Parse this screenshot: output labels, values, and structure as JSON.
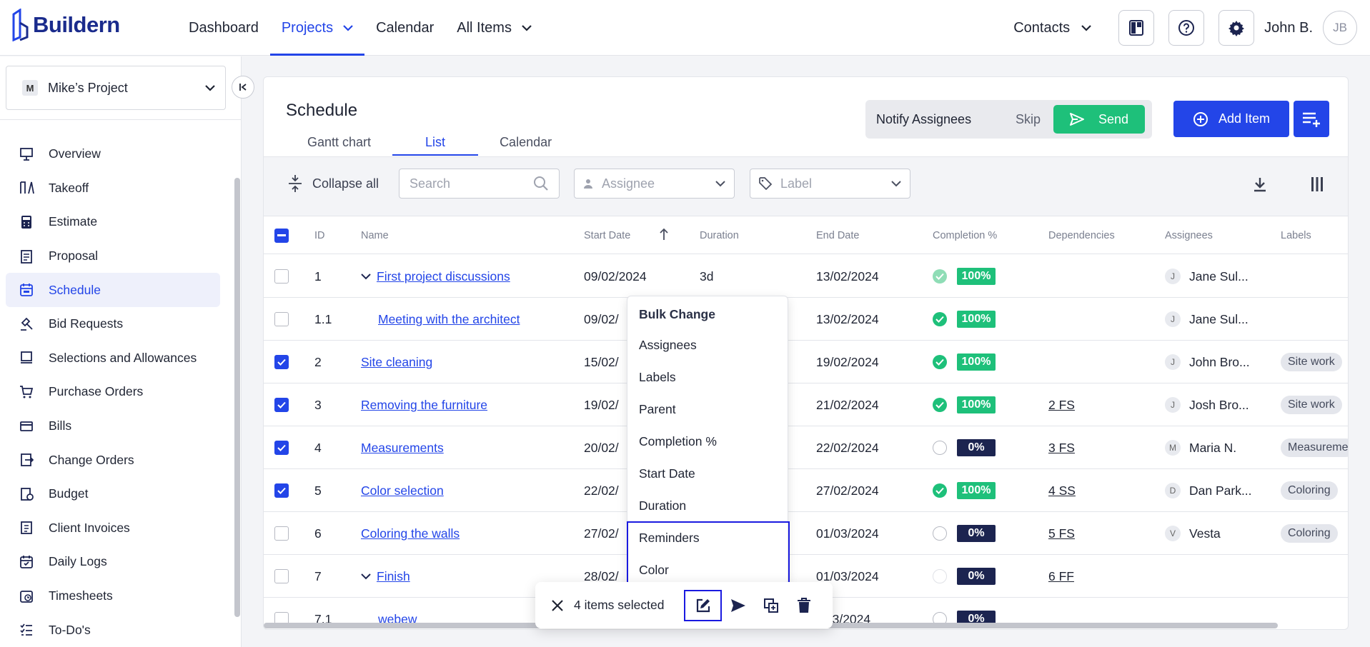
{
  "app": {
    "brand": "Buildern"
  },
  "nav": {
    "items": [
      {
        "label": "Dashboard"
      },
      {
        "label": "Projects"
      },
      {
        "label": "Calendar"
      },
      {
        "label": "All Items"
      }
    ]
  },
  "topright": {
    "contacts": "Contacts",
    "user_name": "John B.",
    "user_initials": "JB"
  },
  "project": {
    "badge": "M",
    "name": "Mike’s Project"
  },
  "sidebar": {
    "items": [
      {
        "label": "Overview",
        "icon": "easel-icon"
      },
      {
        "label": "Takeoff",
        "icon": "takeoff-icon"
      },
      {
        "label": "Estimate",
        "icon": "calculator-icon"
      },
      {
        "label": "Proposal",
        "icon": "proposal-icon"
      },
      {
        "label": "Schedule",
        "icon": "calendar-icon"
      },
      {
        "label": "Bid Requests",
        "icon": "gavel-icon"
      },
      {
        "label": "Selections and Allowances",
        "icon": "monitor-icon"
      },
      {
        "label": "Purchase Orders",
        "icon": "cart-icon"
      },
      {
        "label": "Bills",
        "icon": "card-icon"
      },
      {
        "label": "Change Orders",
        "icon": "change-icon"
      },
      {
        "label": "Budget",
        "icon": "budget-icon"
      },
      {
        "label": "Client Invoices",
        "icon": "invoice-icon"
      },
      {
        "label": "Daily Logs",
        "icon": "log-icon"
      },
      {
        "label": "Timesheets",
        "icon": "timesheet-icon"
      },
      {
        "label": "To-Do's",
        "icon": "todo-icon"
      }
    ]
  },
  "schedule": {
    "title": "Schedule",
    "tabs": [
      {
        "label": "Gantt chart"
      },
      {
        "label": "List"
      },
      {
        "label": "Calendar"
      }
    ],
    "notify": {
      "text": "Notify Assignees",
      "skip": "Skip",
      "send": "Send"
    },
    "add_item": "Add Item"
  },
  "toolbar": {
    "collapse_all": "Collapse all",
    "search_placeholder": "Search",
    "assignee_placeholder": "Assignee",
    "label_placeholder": "Label"
  },
  "table": {
    "columns": [
      "ID",
      "Name",
      "Start Date",
      "Duration",
      "End Date",
      "Completion %",
      "Dependencies",
      "Assignees",
      "Labels"
    ],
    "rows": [
      {
        "id": "1",
        "name": "First project discussions",
        "start": "09/02/2024",
        "duration": "3d",
        "end": "13/02/2024",
        "completion": "100%",
        "deps": "",
        "assignee": "Jane Sul...",
        "initial": "J",
        "label": ""
      },
      {
        "id": "1.1",
        "name": "Meeting with the architect",
        "start": "09/02/",
        "duration": "",
        "end": "13/02/2024",
        "completion": "100%",
        "deps": "",
        "assignee": "Jane Sul...",
        "initial": "J",
        "label": ""
      },
      {
        "id": "2",
        "name": "Site cleaning",
        "start": "15/02/",
        "duration": "",
        "end": "19/02/2024",
        "completion": "100%",
        "deps": "",
        "assignee": "John Bro...",
        "initial": "J",
        "label": "Site work"
      },
      {
        "id": "3",
        "name": "Removing the furniture",
        "start": "19/02/",
        "duration": "",
        "end": "21/02/2024",
        "completion": "100%",
        "deps": "2 FS",
        "assignee": "Josh Bro...",
        "initial": "J",
        "label": "Site work"
      },
      {
        "id": "4",
        "name": "Measurements",
        "start": "20/02/",
        "duration": "",
        "end": "22/02/2024",
        "completion": "0%",
        "deps": "3 FS",
        "assignee": "Maria N.",
        "initial": "M",
        "label": "Measureme"
      },
      {
        "id": "5",
        "name": "Color selection",
        "start": "22/02/",
        "duration": "",
        "end": "27/02/2024",
        "completion": "100%",
        "deps": "4 SS",
        "assignee": "Dan Park...",
        "initial": "D",
        "label": "Coloring"
      },
      {
        "id": "6",
        "name": "Coloring the walls",
        "start": "27/02/",
        "duration": "",
        "end": "01/03/2024",
        "completion": "0%",
        "deps": "5 FS",
        "assignee": "Vesta",
        "initial": "V",
        "label": "Coloring"
      },
      {
        "id": "7",
        "name": "Finish",
        "start": "28/02/",
        "duration": "",
        "end": "01/03/2024",
        "completion": "0%",
        "deps": "6 FF",
        "assignee": "",
        "initial": "",
        "label": ""
      },
      {
        "id": "7.1",
        "name": "webew",
        "start": "",
        "duration": "",
        "end": "/03/2024",
        "completion": "0%",
        "deps": "",
        "assignee": "",
        "initial": "",
        "label": ""
      }
    ]
  },
  "bulk_menu": {
    "heading": "Bulk Change",
    "items": [
      "Assignees",
      "Labels",
      "Parent",
      "Completion %",
      "Start Date",
      "Duration",
      "Reminders",
      "Color"
    ]
  },
  "action_bar": {
    "selected_text": "4 items selected"
  },
  "colors": {
    "accent": "#2345e8",
    "success": "#1ec07a",
    "dark": "#1c2450"
  }
}
